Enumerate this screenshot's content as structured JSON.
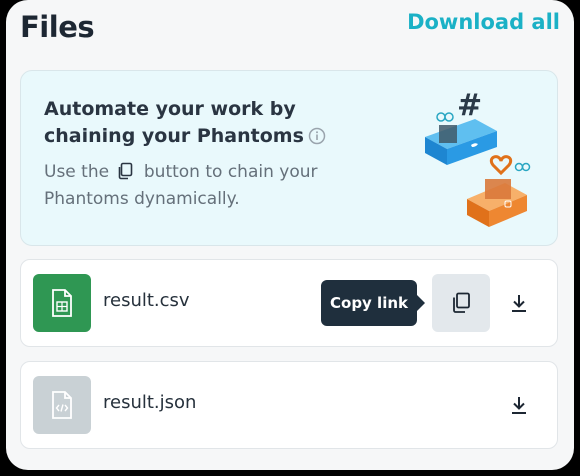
{
  "header": {
    "title": "Files",
    "download_all_label": "Download all"
  },
  "promo": {
    "heading": "Automate your work by chaining your Phantoms",
    "body_before": "Use the",
    "body_after": "button to chain your Phantoms dynamically.",
    "illustration_icons": [
      "hashtag-icon",
      "twitter-icon",
      "heart-icon",
      "instagram-icon"
    ]
  },
  "files": [
    {
      "name": "result.csv",
      "icon": "spreadsheet-file-icon",
      "thumb_color": "#2f9753"
    },
    {
      "name": "result.json",
      "icon": "code-file-icon",
      "thumb_color": "#c9d1d5"
    }
  ],
  "tooltip": {
    "label": "Copy link"
  },
  "colors": {
    "accent": "#1bb1c6",
    "tooltip_bg": "#1f2f3d",
    "promo_bg": "#e9f9fc"
  }
}
